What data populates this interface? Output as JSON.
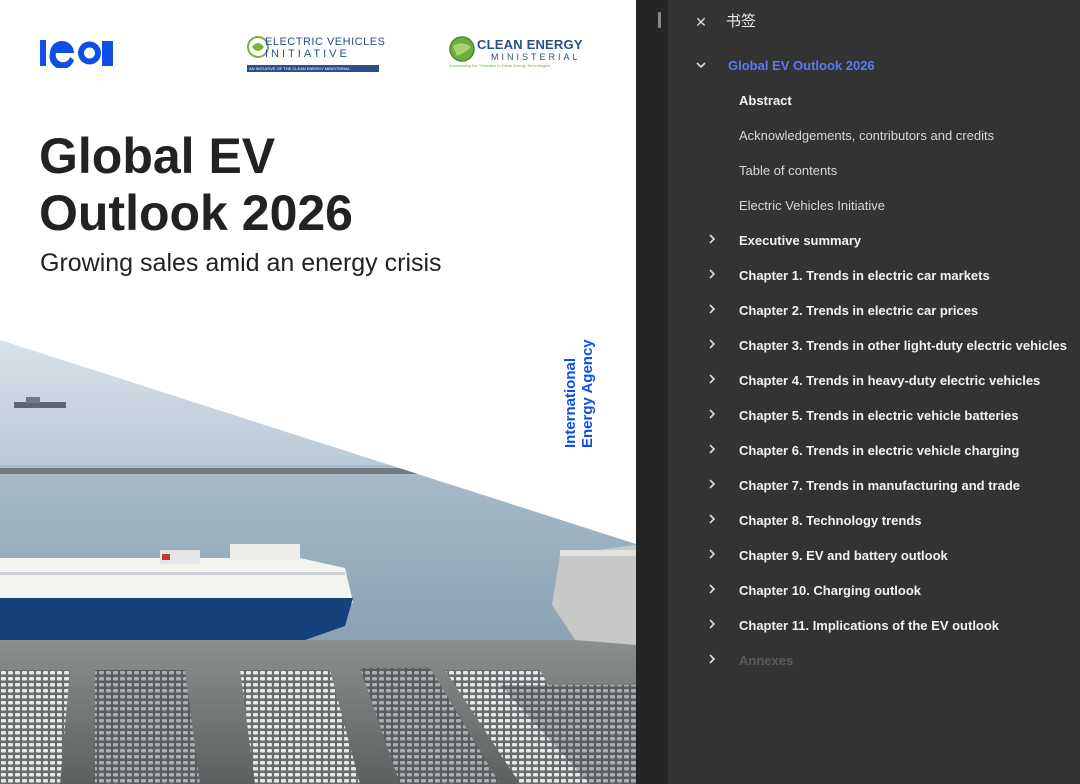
{
  "document": {
    "logos": {
      "iea": "iea",
      "evi": {
        "line1": "ELECTRIC VEHICLES",
        "line2": "INITIATIVE",
        "strip": "AN INITIATIVE OF THE CLEAN ENERGY MINISTERIAL"
      },
      "cem": {
        "line1": "CLEAN ENERGY",
        "line2": "MINISTERIAL",
        "tagline": "Accelerating the Transition to Clean Energy Technologies"
      }
    },
    "title_line1": "Global EV",
    "title_line2": "Outlook 2026",
    "subtitle": "Growing sales amid an energy crisis",
    "vertical_line1": "International",
    "vertical_line2": "Energy Agency"
  },
  "panel": {
    "close_icon": "close-icon",
    "title": "书签",
    "root_label": "Global EV Outlook 2026",
    "items": [
      {
        "label": "Abstract",
        "style": "bold",
        "expandable": false
      },
      {
        "label": "Acknowledgements, contributors and credits",
        "style": "normal",
        "expandable": false
      },
      {
        "label": "Table of contents",
        "style": "normal",
        "expandable": false
      },
      {
        "label": "Electric Vehicles Initiative",
        "style": "normal",
        "expandable": false
      },
      {
        "label": "Executive summary",
        "style": "bold",
        "expandable": true
      },
      {
        "label": "Chapter 1. Trends in electric car markets",
        "style": "bold",
        "expandable": true
      },
      {
        "label": "Chapter 2. Trends in electric car prices",
        "style": "bold",
        "expandable": true
      },
      {
        "label": "Chapter 3. Trends in other light-duty electric vehicles",
        "style": "bold",
        "expandable": true
      },
      {
        "label": "Chapter 4. Trends in heavy-duty electric vehicles",
        "style": "bold",
        "expandable": true
      },
      {
        "label": "Chapter 5. Trends in electric vehicle batteries",
        "style": "bold",
        "expandable": true
      },
      {
        "label": "Chapter 6. Trends in electric vehicle charging",
        "style": "bold",
        "expandable": true
      },
      {
        "label": "Chapter 7. Trends in manufacturing and trade",
        "style": "bold",
        "expandable": true
      },
      {
        "label": "Chapter 8. Technology trends",
        "style": "bold",
        "expandable": true
      },
      {
        "label": "Chapter 9. EV and battery outlook",
        "style": "bold",
        "expandable": true
      },
      {
        "label": "Chapter 10. Charging outlook",
        "style": "bold",
        "expandable": true
      },
      {
        "label": "Chapter 11. Implications of the EV outlook",
        "style": "bold",
        "expandable": true
      },
      {
        "label": "Annexes",
        "style": "faded",
        "expandable": true
      }
    ]
  },
  "colors": {
    "iea_blue": "#0f4fe6",
    "active_bookmark": "#5c78f4",
    "panel_bg": "#333333",
    "ship_hull": "#17417d"
  }
}
